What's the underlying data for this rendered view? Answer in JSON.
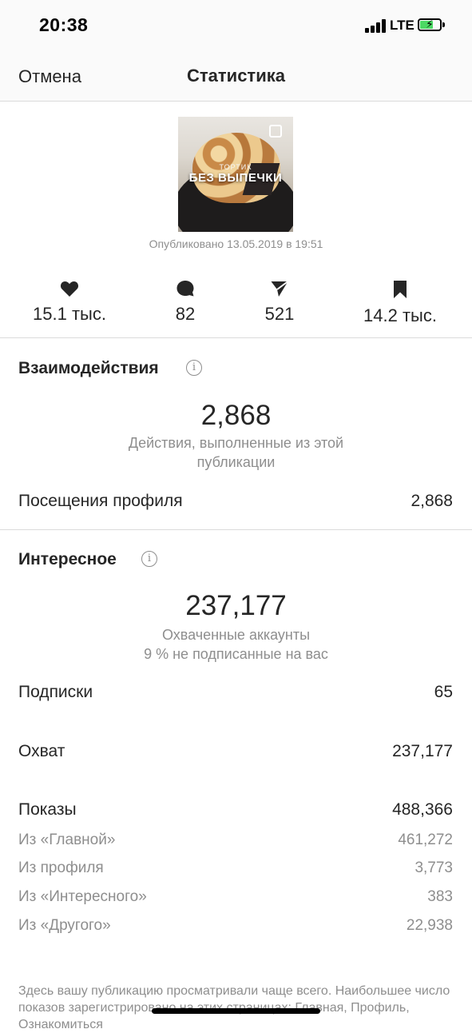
{
  "status_bar": {
    "time": "20:38",
    "network": "LTE"
  },
  "nav": {
    "cancel_label": "Отмена",
    "title": "Статистика"
  },
  "post": {
    "thumbnail_caption_small": "ТОРТИК",
    "thumbnail_caption_big": "БЕЗ ВЫПЕЧКИ",
    "published": "Опубликовано 13.05.2019 в 19:51"
  },
  "metrics": [
    {
      "icon": "heart-icon",
      "value": "15.1 тыс."
    },
    {
      "icon": "comment-icon",
      "value": "82"
    },
    {
      "icon": "share-icon",
      "value": "521"
    },
    {
      "icon": "bookmark-icon",
      "value": "14.2 тыс."
    }
  ],
  "interactions": {
    "title": "Взаимодействия",
    "total": "2,868",
    "caption": "Действия, выполненные из этой\nпубликации",
    "rows": [
      {
        "label": "Посещения профиля",
        "value": "2,868"
      }
    ]
  },
  "discovery": {
    "title": "Интересное",
    "total": "237,177",
    "caption_1": "Охваченные аккаунты",
    "caption_2": "9 % не подписанные на вас",
    "rows": [
      {
        "label": "Подписки",
        "value": "65"
      },
      {
        "label": "Охват",
        "value": "237,177"
      },
      {
        "label": "Показы",
        "value": "488,366"
      }
    ],
    "sub_rows": [
      {
        "label": "Из «Главной»",
        "value": "461,272"
      },
      {
        "label": "Из профиля",
        "value": "3,773"
      },
      {
        "label": "Из «Интересного»",
        "value": "383"
      },
      {
        "label": "Из «Другого»",
        "value": "22,938"
      }
    ]
  },
  "footer": {
    "text": "Здесь вашу публикацию просматривали чаще всего. Наибольшее число показов зарегистрировано на этих страницах: Главная, Профиль, Ознакомиться"
  },
  "colors": {
    "text": "#262626",
    "secondary": "#8e8e8e",
    "divider": "#dbdbdb",
    "battery": "#4cd964"
  }
}
